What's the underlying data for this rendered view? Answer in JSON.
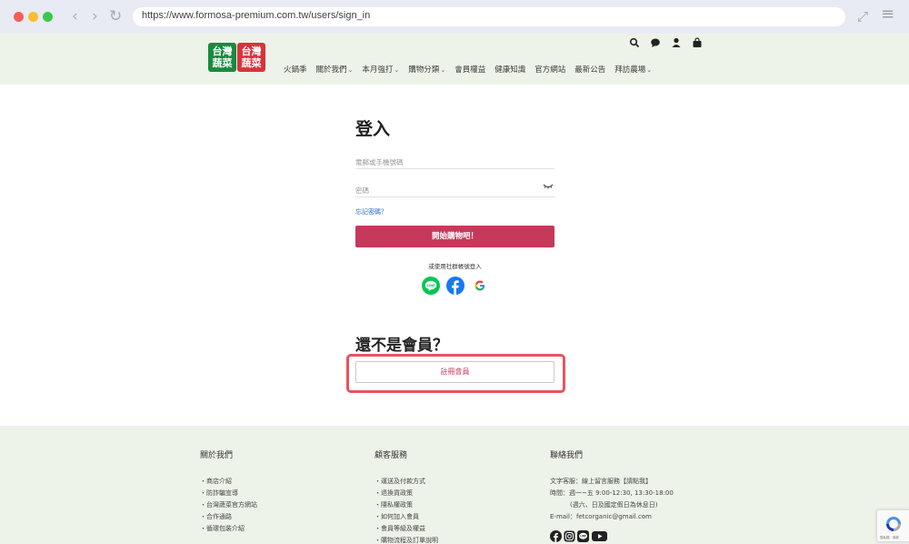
{
  "browser": {
    "url": "https://www.formosa-premium.com.tw/users/sign_in",
    "back_label": "‹",
    "forward_label": "›",
    "reload_label": "↻",
    "expand_label": "⤢",
    "menu_label": "≡"
  },
  "logo": {
    "left_text": "台灣蔬菜",
    "right_text": "台灣蔬菜"
  },
  "nav": {
    "items": [
      {
        "label": "火鍋季",
        "caret": ""
      },
      {
        "label": "關於我們",
        "caret": "⌄"
      },
      {
        "label": "本月強打",
        "caret": "⌄"
      },
      {
        "label": "購物分類",
        "caret": "⌄"
      },
      {
        "label": "會員權益",
        "caret": ""
      },
      {
        "label": "健康知識",
        "caret": ""
      },
      {
        "label": "官方網站",
        "caret": ""
      },
      {
        "label": "最新公告",
        "caret": ""
      },
      {
        "label": "拜訪農場",
        "caret": "⌄"
      }
    ]
  },
  "header_icons": [
    "search-icon",
    "chat-icon",
    "user-icon",
    "cart-icon"
  ],
  "login": {
    "title": "登入",
    "phone_placeholder": "電郵或手機號碼",
    "password_placeholder": "密碼",
    "forgot_label": "忘記密碼？",
    "submit_label": "開始購物吧！",
    "social_caption": "或使用社群帳號登入"
  },
  "register": {
    "title": "還不是會員？",
    "button_label": "註冊會員"
  },
  "footer": {
    "about": {
      "heading": "關於我們",
      "links": [
        "・商店介紹",
        "・防詐騙宣導",
        "・台灣蔬菜官方網站",
        "・合作通路",
        "・循環包裝介紹"
      ]
    },
    "service": {
      "heading": "顧客服務",
      "links": [
        "・運送及付款方式",
        "・退換貨政策",
        "・隱私權政策",
        "・如何加入會員",
        "・會員等級及權益",
        "・購物流程及訂單說明"
      ]
    },
    "contact": {
      "heading": "聯絡我們",
      "lines": [
        "文字客服：線上留言服務【請點我】",
        "時間：週一~五 9:00-12:30, 13:30-18:00",
        "(週六、日及國定假日為休息日)",
        "E-mail：fetcorganic@gmail.com"
      ]
    }
  },
  "colors": {
    "primary": "#c6395a",
    "highlight": "#e8525e",
    "header_bg": "#eef3ea"
  },
  "recaptcha_text": "隱私權 - 條款"
}
